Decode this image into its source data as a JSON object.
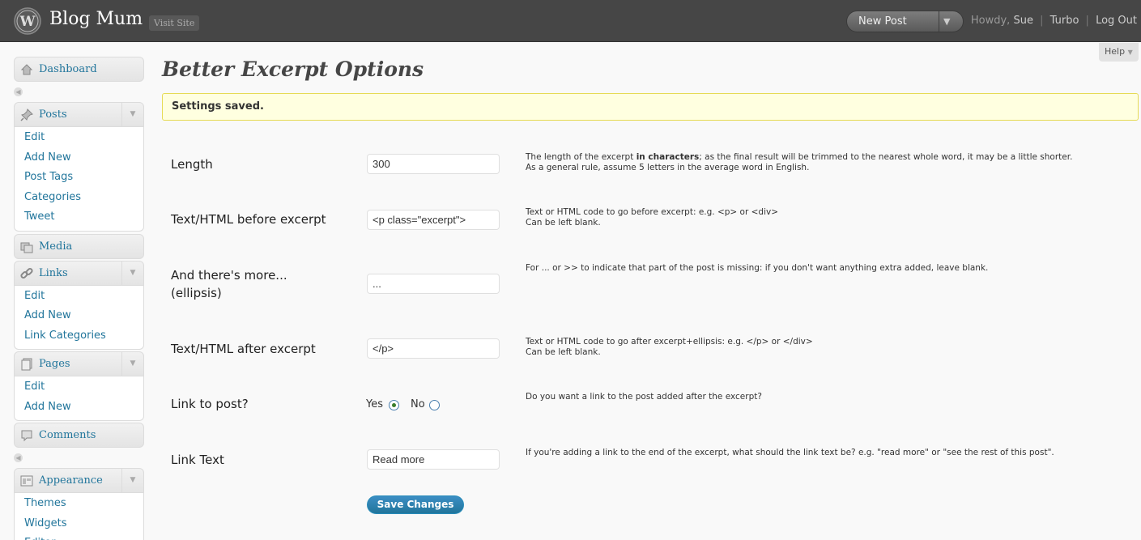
{
  "header": {
    "site_title": "Blog Mum",
    "visit_site": "Visit Site",
    "favorite_action": "New Post",
    "howdy": "Howdy,",
    "user": "Sue",
    "turbo": "Turbo",
    "logout": "Log Out",
    "separator": "|"
  },
  "help": "Help",
  "sidebar": {
    "dashboard": "Dashboard",
    "posts": {
      "label": "Posts",
      "items": [
        "Edit",
        "Add New",
        "Post Tags",
        "Categories",
        "Tweet"
      ]
    },
    "media": "Media",
    "links": {
      "label": "Links",
      "items": [
        "Edit",
        "Add New",
        "Link Categories"
      ]
    },
    "pages": {
      "label": "Pages",
      "items": [
        "Edit",
        "Add New"
      ]
    },
    "comments": "Comments",
    "appearance": {
      "label": "Appearance",
      "items": [
        "Themes",
        "Widgets",
        "Editor"
      ]
    }
  },
  "main": {
    "title": "Better Excerpt Options",
    "notice": "Settings saved.",
    "options": {
      "length": {
        "label": "Length",
        "value": "300",
        "desc_pre": "The length of the excerpt ",
        "desc_bold": "in characters",
        "desc_post": "; as the final result will be trimmed to the nearest whole word, it may be a little shorter.",
        "desc_line2": "As a general rule, assume 5 letters in the average word in English."
      },
      "before": {
        "label": "Text/HTML before excerpt",
        "value": "<p class=\"excerpt\">",
        "desc_line1": "Text or HTML code to go before excerpt: e.g. <p> or <div>",
        "desc_line2": "Can be left blank."
      },
      "ellipsis": {
        "label_line1": "And there's more...",
        "label_line2": "(ellipsis)",
        "value": "...",
        "desc_line1": "For ... or >> to indicate that part of the post is missing: if you don't want anything extra added, leave blank."
      },
      "after": {
        "label": "Text/HTML after excerpt",
        "value": "</p>",
        "desc_line1": "Text or HTML code to go after excerpt+ellipsis: e.g. </p> or </div>",
        "desc_line2": "Can be left blank."
      },
      "link": {
        "label": "Link to post?",
        "yes": "Yes",
        "no": "No",
        "selected": "Yes",
        "desc_line1": "Do you want a link to the post added after the excerpt?"
      },
      "link_text": {
        "label": "Link Text",
        "value": "Read more",
        "desc_line1": "If you're adding a link to the end of the excerpt, what should the link text be? e.g. \"read more\" or \"see the rest of this post\"."
      }
    },
    "save_button": "Save Changes"
  }
}
